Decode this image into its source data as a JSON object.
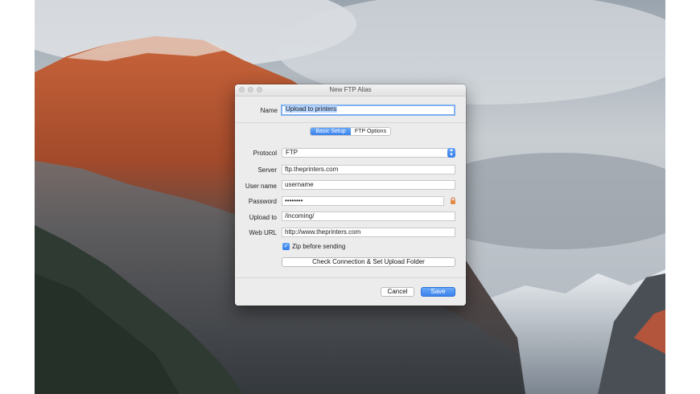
{
  "dialog": {
    "title": "New FTP Alias",
    "name_label": "Name",
    "name_value": "Upload to printers",
    "tabs": [
      {
        "label": "Basic Setup",
        "active": true
      },
      {
        "label": "FTP Options",
        "active": false
      }
    ],
    "protocol": {
      "label": "Protocol",
      "value": "FTP"
    },
    "server": {
      "label": "Server",
      "value": "ftp.theprinters.com"
    },
    "username": {
      "label": "User name",
      "value": "username"
    },
    "password": {
      "label": "Password",
      "value": "••••••••"
    },
    "upload_to": {
      "label": "Upload to",
      "value": "/incoming/"
    },
    "web_url": {
      "label": "Web URL",
      "value": "http://www.theprinters.com"
    },
    "zip_checkbox": {
      "label": "Zip before sending",
      "checked": true
    },
    "check_button": "Check Connection & Set Upload Folder",
    "cancel_button": "Cancel",
    "save_button": "Save"
  },
  "colors": {
    "accent": "#3b83ee",
    "dialog_bg": "#ececec"
  },
  "icons": [
    "lock-icon",
    "checkmark-icon",
    "stepper-arrows-icon"
  ]
}
